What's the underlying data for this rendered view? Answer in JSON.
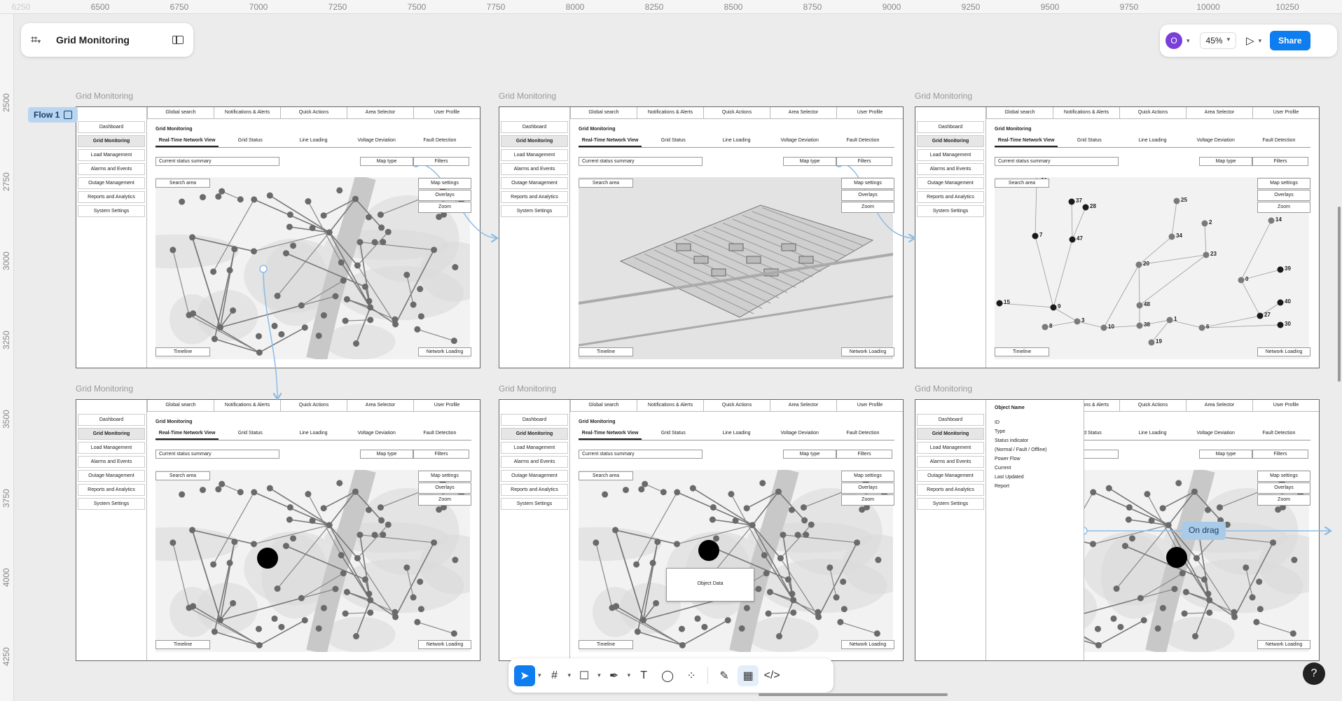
{
  "app": {
    "file_title": "Grid Monitoring"
  },
  "ruler": {
    "x_ticks": [
      "6250",
      "6500",
      "6750",
      "7000",
      "7250",
      "7500",
      "7750",
      "8000",
      "8250",
      "8500",
      "8750",
      "9000",
      "9250",
      "9500",
      "9750",
      "10000",
      "10250"
    ],
    "y_ticks": [
      "2500",
      "2750",
      "3000",
      "3250",
      "3500",
      "3750",
      "4000",
      "4250"
    ]
  },
  "header_right": {
    "avatar_initial": "O",
    "zoom": "45%",
    "share_label": "Share"
  },
  "flow": {
    "label": "Flow 1"
  },
  "wireframe": {
    "frame_label": "Grid Monitoring",
    "page_title": "Grid Monitoring",
    "nav_items": [
      "Dashboard",
      "Grid Monitoring",
      "Load Management",
      "Alarms and Events",
      "Outage Management",
      "Reports and Analytics",
      "System Settings"
    ],
    "top_items": [
      "Global search",
      "Notifications & Alerts",
      "Quick Actions",
      "Area Selector",
      "User Profile"
    ],
    "tabs": [
      "Real-Time Network View",
      "Grid Status",
      "Line Loading",
      "Voltage Deviation",
      "Fault Detection"
    ],
    "status_summary": "Current status summary",
    "map_type": "Map type",
    "filters": "Filters",
    "search_area": "Search area",
    "map_settings": "Map settings",
    "overlays": "Overlays",
    "zoom": "Zoom",
    "timeline": "Timeline",
    "network_loading": "Network Loading",
    "object_data": "Object Data",
    "object_panel": {
      "title": "Object Name",
      "fields": [
        "ID",
        "Type",
        "Status indicator",
        "(Normal / Fault / Offline)",
        "Power Flow",
        "Current",
        "Last Updated",
        "Report"
      ]
    },
    "node_numbers": [
      "21",
      "37",
      "28",
      "25",
      "2",
      "14",
      "7",
      "47",
      "34",
      "23",
      "20",
      "39",
      "0",
      "40",
      "48",
      "27",
      "15",
      "9",
      "3",
      "10",
      "38",
      "1",
      "6",
      "30",
      "8",
      "19"
    ]
  },
  "interaction": {
    "drag_label": "On drag"
  },
  "toolbar": {
    "tools": [
      "move-tool",
      "frame-tool",
      "shape-tool",
      "pen-tool",
      "text-tool",
      "comment-tool",
      "actions-tool",
      "draw-mode",
      "design-mode",
      "dev-mode"
    ]
  },
  "help": {
    "label": "?"
  }
}
